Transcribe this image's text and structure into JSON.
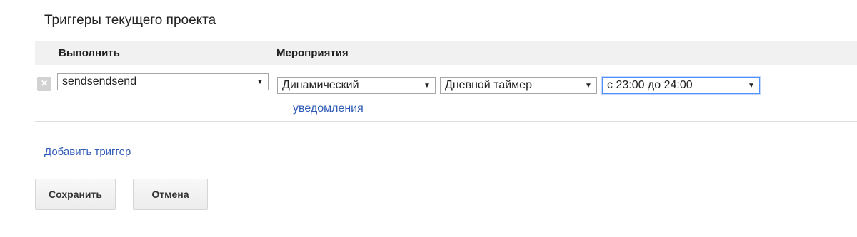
{
  "page": {
    "title": "Триггеры текущего проекта"
  },
  "table": {
    "columns": {
      "run": "Выполнить",
      "events": "Мероприятия"
    },
    "rows": [
      {
        "remove_icon": "×",
        "run_select": "sendsendsend",
        "event_type_select": "Динамический",
        "event_source_select": "Дневной таймер",
        "time_range_select": "с 23:00 до 24:00",
        "notifications_link": "уведомления"
      }
    ]
  },
  "actions": {
    "add_trigger": "Добавить триггер",
    "save": "Сохранить",
    "cancel": "Отмена"
  },
  "icons": {
    "remove": "close-icon",
    "dropdown": "caret-down-icon"
  },
  "colors": {
    "link": "#2f5bb7",
    "header_bg": "#f1f1f1",
    "focus_border": "#4d90fe"
  }
}
